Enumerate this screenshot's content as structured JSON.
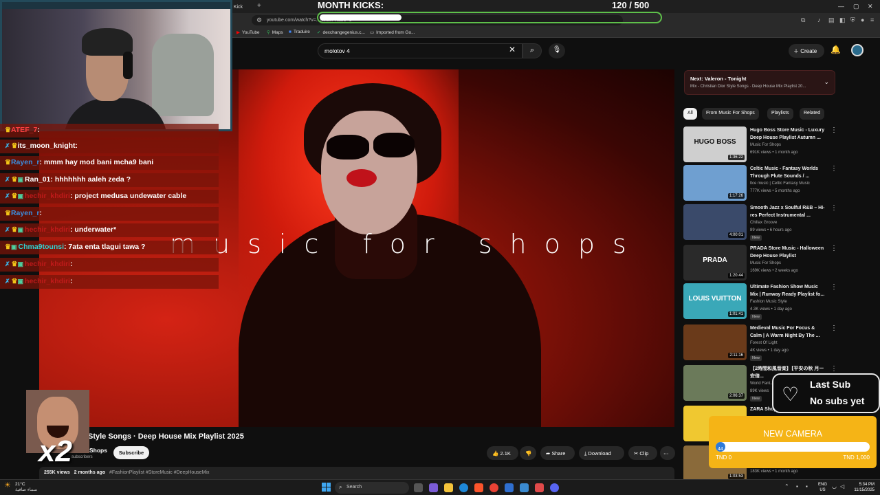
{
  "browser": {
    "active_tab": "n Kick",
    "url": "youtube.com/watch?v=...&start_radio=1",
    "bookmarks": [
      {
        "label": "YouTube",
        "icon": "youtube-icon",
        "color": "#ff0000"
      },
      {
        "label": "Maps",
        "icon": "maps-icon",
        "color": "#34a853"
      },
      {
        "label": "Traduire",
        "icon": "translate-icon",
        "color": "#4285f4"
      },
      {
        "label": "dexchangegenius.c...",
        "icon": "check-icon",
        "color": "#2ecc71"
      },
      {
        "label": "Imported from Go...",
        "icon": "folder-icon",
        "color": "#cccccc"
      }
    ]
  },
  "kicks_overlay": {
    "title": "MONTH KICKS:",
    "count": "120  /  500",
    "current": 120,
    "goal": 500
  },
  "youtube": {
    "search_value": "molotov 4",
    "create_label": "Create",
    "video": {
      "watermark": "music for shops",
      "title": "Style Songs · Deep House Mix Playlist 2025",
      "channel": "Shops",
      "subs": "subscribers",
      "subscribe_label": "Subscribe",
      "likes": "2.1K",
      "share": "Share",
      "download": "Download",
      "clip": "Clip",
      "views": "255K views",
      "date": "2 months ago",
      "tags": "#FashionPlaylist #StoreMusic #DeepHouseMix"
    },
    "up_next": {
      "title": "Next: Valeron - Tonight",
      "subtitle": "Mix - Christian Dior Style Songs · Deep House Mix Playlist 20..."
    },
    "chips": [
      "All",
      "From Music For Shops",
      "Playlists",
      "Related"
    ],
    "recommendations": [
      {
        "title": "Hugo Boss Store Music - Luxury Deep House Playlist Autumn ...",
        "channel": "Music For Shops",
        "meta": "691K views • 1 month ago",
        "duration": "1:36:22",
        "thumb_text": "HUGO BOSS",
        "new": "",
        "color": "#cfcfcf"
      },
      {
        "title": "Celtic Music - Fantasy Worlds Through Flute Sounds / ...",
        "channel": "tlce music | Celtic Fantasy Music",
        "meta": "777K views • 5 months ago",
        "duration": "1:17:26",
        "thumb_text": "",
        "new": "",
        "color": "#6f9fd0"
      },
      {
        "title": "Smooth Jazz x Soulful R&B – Hi-res Perfect Instrumental ...",
        "channel": "Chillax Groove",
        "meta": "89 views • 6 hours ago",
        "duration": "4:00:01",
        "thumb_text": "",
        "new": "New",
        "color": "#3a4a6a"
      },
      {
        "title": "PRADA Store Music - Halloween Deep House Playlist",
        "channel": "Music For Shops",
        "meta": "169K views • 2 weeks ago",
        "duration": "1:20:44",
        "thumb_text": "PRADA",
        "new": "",
        "color": "#2a2a2a"
      },
      {
        "title": "Ultimate Fashion Show Music Mix | Runway Ready Playlist fo...",
        "channel": "Fashion Music Style",
        "meta": "4.3K views • 1 day ago",
        "duration": "1:01:41",
        "thumb_text": "LOUIS VUITTON",
        "new": "New",
        "color": "#3aa8b8"
      },
      {
        "title": "Medieval Music For Focus & Calm | A Warm Night By The ...",
        "channel": "Forest Of Light",
        "meta": "4K views • 1 day ago",
        "duration": "2:11:16",
        "thumb_text": "",
        "new": "New",
        "color": "#6a3a1a"
      },
      {
        "title": "【2時間和風音楽】【平安の秋 月ー安倍...",
        "channel": "World Fant...",
        "meta": "89K views",
        "duration": "2:06:37",
        "thumb_text": "",
        "new": "New",
        "color": "#6b7a5a"
      },
      {
        "title": "ZARA Shop...",
        "channel": "",
        "meta": "",
        "duration": "",
        "thumb_text": "Z",
        "new": "",
        "color": "#f0c830"
      },
      {
        "title": "",
        "channel": "",
        "meta": "183K views • 1 month ago",
        "duration": "1:03:53",
        "thumb_text": "",
        "new": "",
        "color": "#8a6a3a"
      }
    ]
  },
  "chat": [
    {
      "user": "ATEF_7",
      "msg": "",
      "user_color": "#ff4040",
      "crown": true,
      "sword": false,
      "tier": false
    },
    {
      "user": "its_moon_knight",
      "msg": "",
      "user_color": "#ffffff",
      "crown": true,
      "sword": true,
      "tier": false
    },
    {
      "user": "Rayen_r",
      "msg": "mmm hay mod bani mcha9 bani",
      "user_color": "#3a8fe0",
      "crown": true,
      "sword": false,
      "tier": false
    },
    {
      "user": "Ran_01",
      "msg": "hhhhhhh aaleh zeda ?",
      "user_color": "#ffffff",
      "crown": true,
      "sword": true,
      "tier": true
    },
    {
      "user": "hechir_khdiri",
      "msg": "project medusa undewater cable",
      "user_color": "#c01a1a",
      "crown": true,
      "sword": true,
      "tier": true
    },
    {
      "user": "Rayen_r",
      "msg": "",
      "user_color": "#3a8fe0",
      "crown": true,
      "sword": false,
      "tier": false
    },
    {
      "user": "hechir_khdiri",
      "msg": "underwater*",
      "user_color": "#c01a1a",
      "crown": true,
      "sword": true,
      "tier": true
    },
    {
      "user": "Chma9tounsi",
      "msg": "7ata enta tlagui tawa ?",
      "user_color": "#30d0d0",
      "crown": true,
      "sword": false,
      "tier": true
    },
    {
      "user": "hechir_khdiri",
      "msg": "",
      "user_color": "#c01a1a",
      "crown": true,
      "sword": true,
      "tier": true
    },
    {
      "user": "hechir_khdiri",
      "msg": "",
      "user_color": "#c01a1a",
      "crown": true,
      "sword": true,
      "tier": true
    }
  ],
  "emote": {
    "multiplier": "x2"
  },
  "last_sub": {
    "title": "Last Sub",
    "value": "No subs yet"
  },
  "camera_goal": {
    "title": "NEW CAMERA",
    "progress_label": "44",
    "low": "TND 0",
    "high": "TND 1,000",
    "current": 44,
    "target": 1000
  },
  "taskbar": {
    "weather_temp": "21°C",
    "weather_desc": "سماء صافية",
    "search_label": "Search",
    "lang_top": "ENG",
    "lang_bottom": "US",
    "time": "5:34 PM",
    "date": "11/15/2025"
  }
}
